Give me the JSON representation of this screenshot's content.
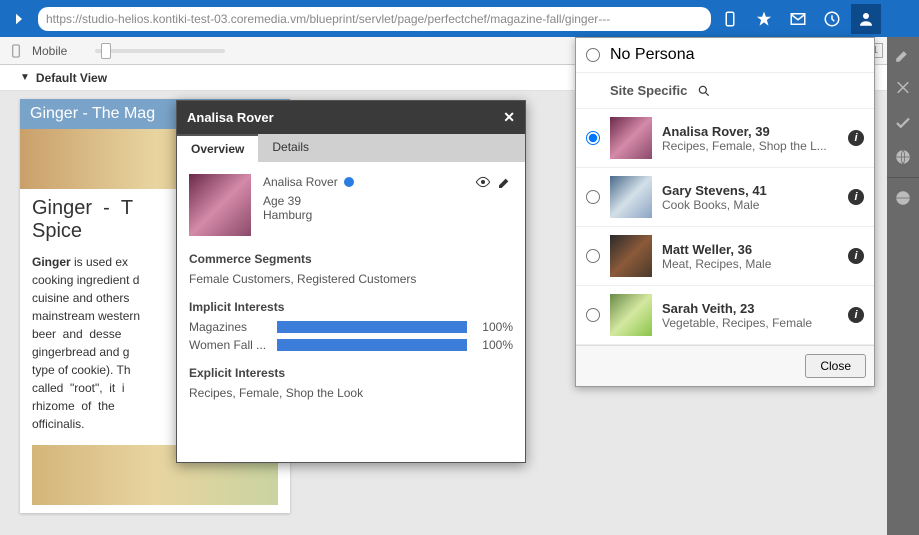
{
  "url": "https://studio-helios.kontiki-test-03.coremedia.vm/blueprint/servlet/page/perfectchef/magazine-fall/ginger---",
  "subbar": {
    "device_label": "Mobile"
  },
  "view": {
    "label": "Default View"
  },
  "article": {
    "banner": "Ginger - The Mag",
    "heading": "Ginger - The Magical Spice",
    "body_html": "<b>Ginger</b> is used extensively as a cooking ingredient in Asian cuisine and others. In mainstream western cooking, beer and desserts like gingerbread and gingersnaps (a type of cookie). Though often called \"root\", it is actually the rhizome of the Zingiber officinalis."
  },
  "persona_panel": {
    "no_persona": "No Persona",
    "site_specific": "Site Specific",
    "close": "Close",
    "items": [
      {
        "name": "Analisa Rover, 39",
        "meta": "Recipes, Female, Shop the L...",
        "avatar": "av-analisa",
        "selected": true
      },
      {
        "name": "Gary Stevens, 41",
        "meta": "Cook Books, Male",
        "avatar": "av-gary",
        "selected": false
      },
      {
        "name": "Matt Weller, 36",
        "meta": "Meat, Recipes, Male",
        "avatar": "av-matt",
        "selected": false
      },
      {
        "name": "Sarah Veith, 23",
        "meta": "Vegetable, Recipes, Female",
        "avatar": "av-sarah",
        "selected": false
      }
    ]
  },
  "dialog": {
    "title": "Analisa Rover",
    "tabs": {
      "overview": "Overview",
      "details": "Details"
    },
    "profile": {
      "name": "Analisa Rover",
      "age": "Age 39",
      "city": "Hamburg"
    },
    "segments": {
      "title": "Commerce Segments",
      "value": "Female Customers, Registered Customers"
    },
    "implicit": {
      "title": "Implicit Interests",
      "rows": [
        {
          "label": "Magazines",
          "pct": "100%"
        },
        {
          "label": "Women Fall ...",
          "pct": "100%"
        }
      ]
    },
    "explicit": {
      "title": "Explicit Interests",
      "value": "Recipes, Female, Shop the Look"
    }
  }
}
